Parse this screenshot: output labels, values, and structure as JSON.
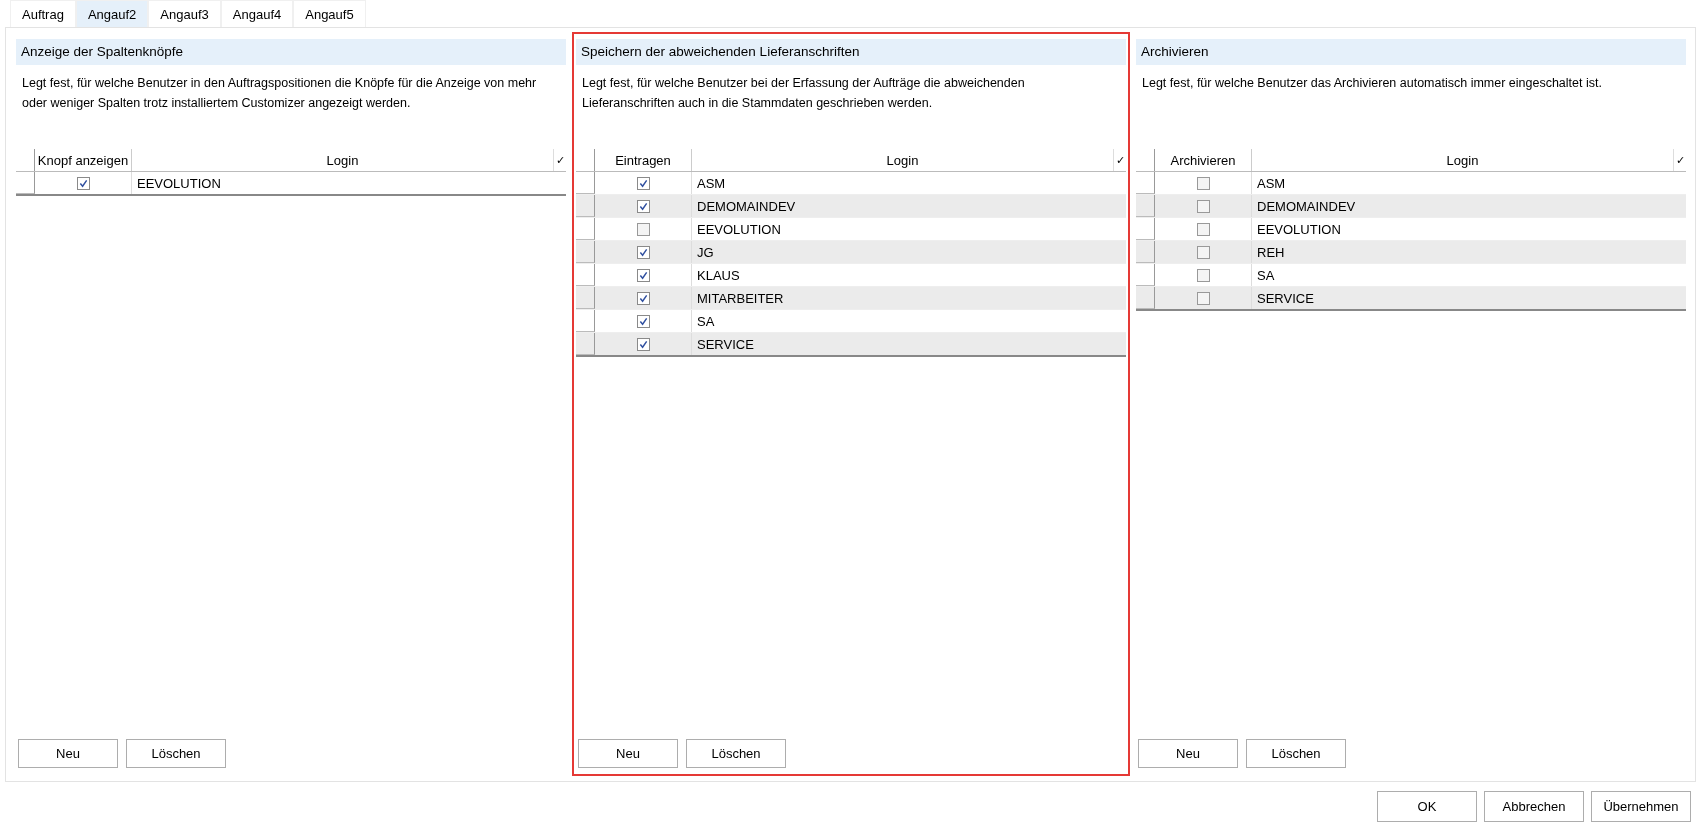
{
  "tabs": [
    {
      "label": "Auftrag",
      "selected": false
    },
    {
      "label": "Angauf2",
      "selected": true
    },
    {
      "label": "Angauf3",
      "selected": false
    },
    {
      "label": "Angauf4",
      "selected": false
    },
    {
      "label": "Angauf5",
      "selected": false
    }
  ],
  "panels": [
    {
      "title": "Anzeige der Spaltenknöpfe",
      "highlighted": false,
      "description": "Legt fest, für welche Benutzer in den Auftragspositionen die Knöpfe für die Anzeige von mehr oder weniger Spalten trotz installiertem Customizer angezeigt werden.",
      "columns": [
        "Knopf anzeigen",
        "Login"
      ],
      "header_mark": "✓",
      "rows": [
        {
          "login": "EEVOLUTION",
          "checked": true
        }
      ],
      "buttons": [
        "Neu",
        "Löschen"
      ]
    },
    {
      "title": "Speichern der abweichenden Lieferanschriften",
      "highlighted": true,
      "description": "Legt fest, für welche Benutzer bei der Erfassung der Aufträge die abweichenden Lieferanschriften auch in die Stammdaten geschrieben werden.",
      "columns": [
        "Eintragen",
        "Login"
      ],
      "header_mark": "✓",
      "rows": [
        {
          "login": "ASM",
          "checked": true
        },
        {
          "login": "DEMOMAINDEV",
          "checked": true
        },
        {
          "login": "EEVOLUTION",
          "checked": false
        },
        {
          "login": "JG",
          "checked": true
        },
        {
          "login": "KLAUS",
          "checked": true
        },
        {
          "login": "MITARBEITER",
          "checked": true
        },
        {
          "login": "SA",
          "checked": true
        },
        {
          "login": "SERVICE",
          "checked": true
        }
      ],
      "buttons": [
        "Neu",
        "Löschen"
      ]
    },
    {
      "title": "Archivieren",
      "highlighted": false,
      "description": "Legt fest, für welche Benutzer das Archivieren automatisch immer eingeschaltet ist.",
      "columns": [
        "Archivieren",
        "Login"
      ],
      "header_mark": "✓",
      "rows": [
        {
          "login": "ASM",
          "checked": false
        },
        {
          "login": "DEMOMAINDEV",
          "checked": false
        },
        {
          "login": "EEVOLUTION",
          "checked": false
        },
        {
          "login": "REH",
          "checked": false
        },
        {
          "login": "SA",
          "checked": false
        },
        {
          "login": "SERVICE",
          "checked": false
        }
      ],
      "buttons": [
        "Neu",
        "Löschen"
      ]
    }
  ],
  "dialog_buttons": [
    "OK",
    "Abbrechen",
    "Übernehmen"
  ]
}
